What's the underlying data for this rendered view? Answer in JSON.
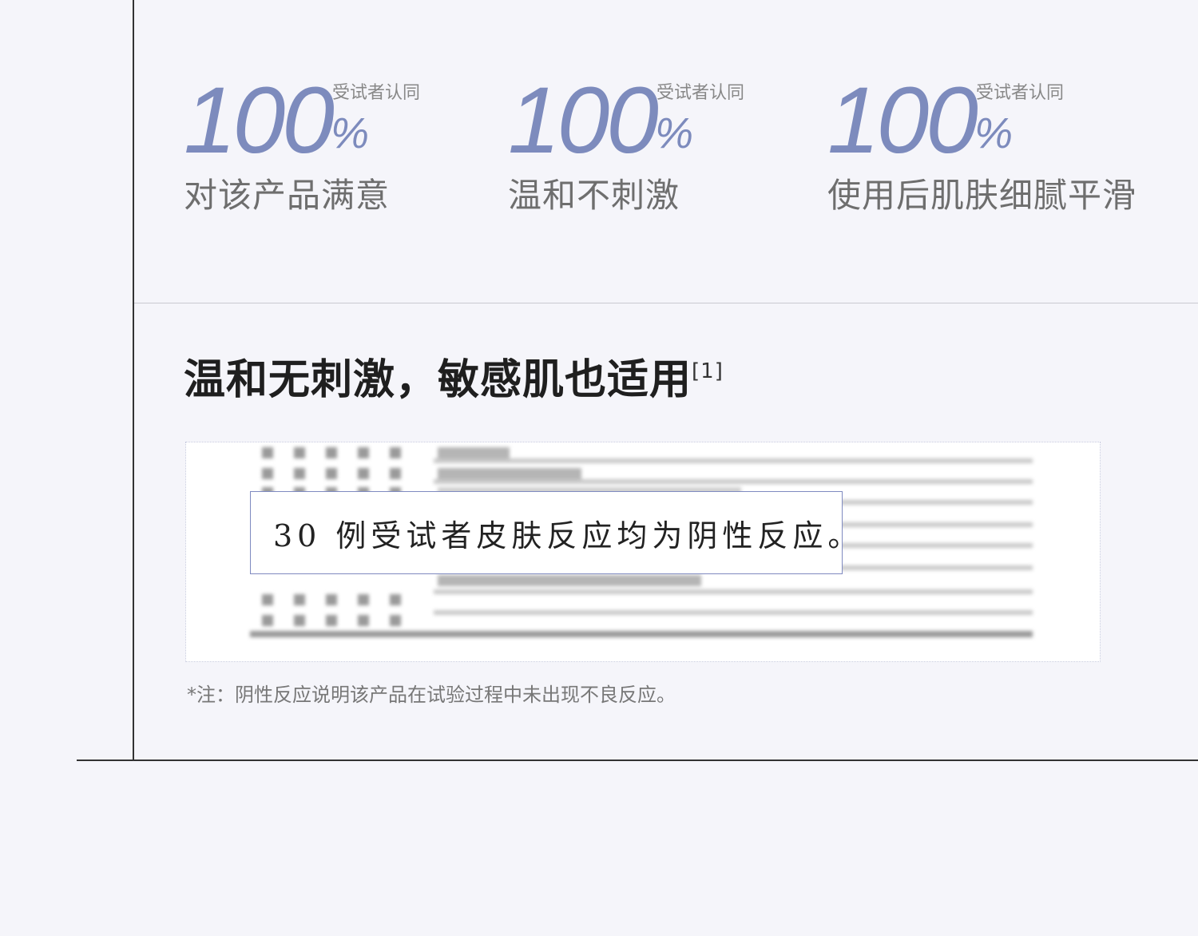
{
  "stats": [
    {
      "number": "100",
      "percent": "%",
      "badge": "受试者认同",
      "label": "对该产品满意"
    },
    {
      "number": "100",
      "percent": "%",
      "badge": "受试者认同",
      "label": "温和不刺激"
    },
    {
      "number": "100",
      "percent": "%",
      "badge": "受试者认同",
      "label": "使用后肌肤细腻平滑"
    }
  ],
  "section": {
    "heading": "温和无刺激，敏感肌也适用",
    "heading_ref": "[1]",
    "callout": "30 例受试者皮肤反应均为阴性反应。",
    "note": "*注：阴性反应说明该产品在试验过程中未出现不良反应。"
  },
  "colors": {
    "accent": "#7d8bbd",
    "background": "#f5f5fa",
    "rule": "#333333"
  }
}
